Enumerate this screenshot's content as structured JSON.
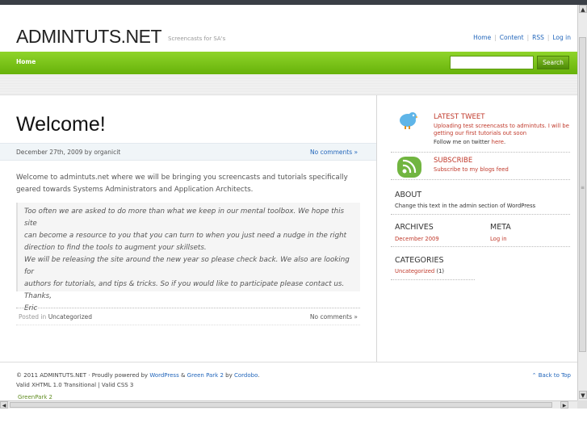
{
  "header": {
    "logo": "ADMINTUTS.NET",
    "tagline": "Screencasts for SA's",
    "links": [
      "Home",
      "Content",
      "RSS",
      "Log in"
    ]
  },
  "nav": {
    "home": "Home",
    "search_button": "Search",
    "search_value": ""
  },
  "post": {
    "title": "Welcome!",
    "date": "December 27th, 2009 by organicit",
    "comments_top": "No comments »",
    "body": "Welcome to admintuts.net where we will be bringing you screencasts and tutorials specifically geared towards Systems Administrators and Application Architects.",
    "quote_lines": [
      "Too often we are asked to do more than what we keep in our mental toolbox. We hope this site",
      "can become a resource to you that you can turn to when you just need a nudge in the right",
      "direction to find the tools to augment your skillsets.",
      "We will be releasing the site around the new year so please check back. We also are looking for",
      "authors for tutorials, and tips & tricks. So if you would like to participate please contact us.",
      "Thanks,",
      "Eric"
    ],
    "posted_in_label": "Posted in",
    "category": "Uncategorized",
    "comments_bottom": "No comments »"
  },
  "sidebar": {
    "tweet_heading": "LATEST TWEET",
    "tweet_text_1": "Uploading test screencasts to admintuts. I will be",
    "tweet_text_2": "getting our first tutorials out soon",
    "follow_prefix": "Follow me on twitter",
    "follow_link": "here",
    "follow_suffix": ".",
    "subscribe_heading": "SUBSCRIBE",
    "subscribe_text": "Subscribe to my blogs feed",
    "about_heading": "ABOUT",
    "about_text": "Change this text in the admin section of WordPress",
    "archives_heading": "ARCHIVES",
    "archives_item": "December 2009",
    "meta_heading": "META",
    "meta_item": "Log in",
    "categories_heading": "CATEGORIES",
    "categories_item": "Uncategorized",
    "categories_count": "(1)"
  },
  "footer": {
    "copyright_prefix": "© 2011 ADMINTUTS.NET · Proudly powered by",
    "wordpress": "WordPress",
    "amp": "&",
    "greenpark": "Green Park 2",
    "by": "by",
    "author": "Cordobo",
    "dot": ".",
    "validity": "Valid XHTML 1.0 Transitional | Valid CSS 3",
    "back_to_top": "Back to Top",
    "greenpark_logo": "GreenPark 2"
  },
  "colors": {
    "accent_green": "#67b20a",
    "link_blue": "#2266bb",
    "sidebar_red": "#c0392b"
  }
}
